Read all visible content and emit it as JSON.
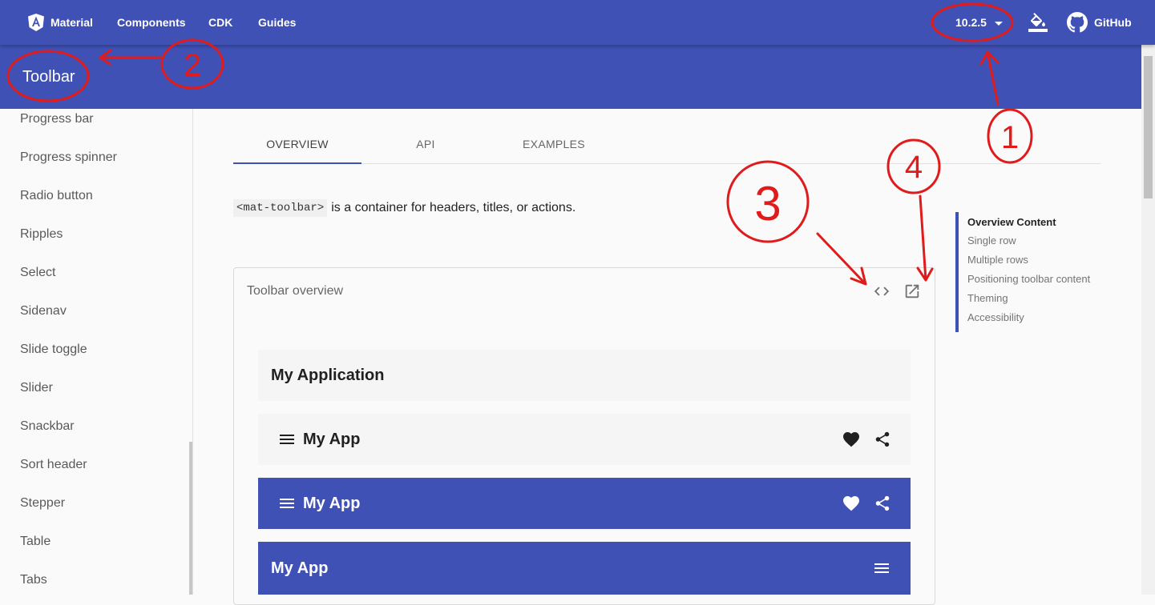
{
  "topnav": {
    "brand": "Material",
    "links": [
      "Components",
      "CDK",
      "Guides"
    ],
    "version": "10.2.5",
    "github": "GitHub"
  },
  "header": {
    "title": "Toolbar"
  },
  "sidenav": {
    "items": [
      "Progress bar",
      "Progress spinner",
      "Radio button",
      "Ripples",
      "Select",
      "Sidenav",
      "Slide toggle",
      "Slider",
      "Snackbar",
      "Sort header",
      "Stepper",
      "Table",
      "Tabs"
    ]
  },
  "tabs": [
    "OVERVIEW",
    "API",
    "EXAMPLES"
  ],
  "intro": {
    "code": "<mat-toolbar>",
    "text": "is a container for headers, titles, or actions."
  },
  "toc": [
    "Overview Content",
    "Single row",
    "Multiple rows",
    "Positioning toolbar content",
    "Theming",
    "Accessibility"
  ],
  "example": {
    "title": "Toolbar overview",
    "toolbars": [
      "My Application",
      "My App",
      "My App",
      "My App"
    ]
  },
  "annotations": [
    "2",
    "1",
    "3",
    "4"
  ],
  "colors": {
    "primary": "#3f51b5",
    "annotation": "#e01b1b"
  }
}
